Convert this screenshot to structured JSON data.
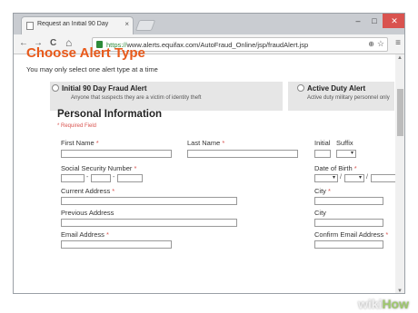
{
  "browser": {
    "tab_title": "Request an Initial 90 Day",
    "tab_close": "×",
    "url_scheme": "https://",
    "url_host": "www.alerts.equifax.com",
    "url_path": "/AutoFraud_Online/jsp/fraudAlert.jsp",
    "nav": {
      "back": "←",
      "forward": "→",
      "reload": "C",
      "home": "⌂"
    },
    "window": {
      "minimize": "–",
      "maximize": "□",
      "close": "✕"
    }
  },
  "page": {
    "heading": "Choose Alert Type",
    "subheading": "You may only select one alert type at a time",
    "options": [
      {
        "title": "Initial 90 Day Fraud Alert",
        "description": "Anyone that suspects they are a victim of identity theft"
      },
      {
        "title": "Active Duty Alert",
        "description": "Active duty military personnel only"
      }
    ],
    "section_title": "Personal Information",
    "required_note": "* Required Field",
    "fields": {
      "first_name": "First Name",
      "last_name": "Last Name",
      "initial": "Initial",
      "suffix": "Suffix",
      "ssn": "Social Security Number",
      "dob": "Date of Birth",
      "current_address": "Current Address",
      "city": "City",
      "previous_address": "Previous Address",
      "previous_city": "City",
      "email": "Email Address",
      "confirm_email": "Confirm Email Address"
    },
    "required_marker": "*",
    "ssn_separator": "-",
    "dob_separator": "/"
  },
  "watermark": {
    "part1": "wiki",
    "part2": "How"
  },
  "colors": {
    "accent": "#e8591a",
    "required": "#d9534f",
    "secure": "#2e8b3a"
  }
}
